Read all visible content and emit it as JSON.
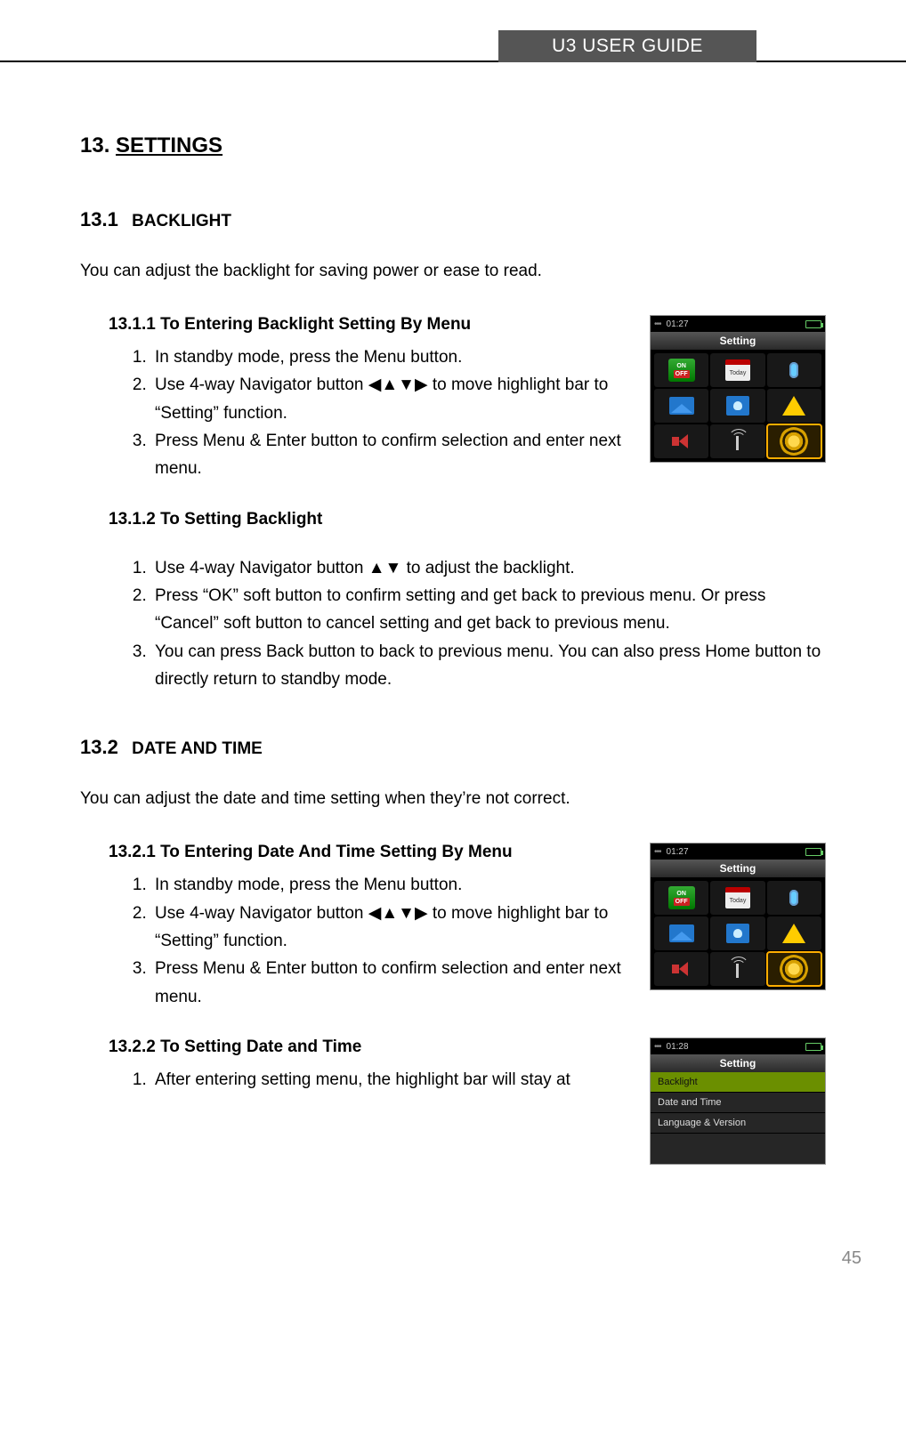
{
  "header": {
    "title": "U3 USER GUIDE"
  },
  "page_number": "45",
  "sections": {
    "h1_num": "13.",
    "h1_title": "SETTINGS",
    "s131": {
      "num": "13.1",
      "title": "BACKLIGHT",
      "intro": "You can adjust the backlight for saving power or ease to read.",
      "s1311": {
        "title": "13.1.1  To Entering Backlight Setting By Menu",
        "steps": [
          "In standby mode, press the Menu button.",
          "Use 4-way Navigator button ◀▲▼▶ to move highlight bar to “Setting” function.",
          "Press Menu & Enter button to confirm selection and enter next menu."
        ]
      },
      "s1312": {
        "title": "13.1.2  To Setting Backlight",
        "steps": [
          "Use 4-way Navigator button    ▲▼ to adjust the backlight.",
          "Press “OK” soft button to confirm setting and get back to previous menu. Or press “Cancel” soft button to cancel setting and get back to previous menu.",
          " You can press Back button to back to previous menu. You can also press Home button to directly return to standby mode."
        ]
      }
    },
    "s132": {
      "num": "13.2",
      "title": "DATE AND TIME",
      "intro": "You can adjust the date and time setting when they’re not correct.",
      "s1321": {
        "title": "13.2.1  To Entering Date And Time Setting By Menu",
        "steps": [
          "In standby mode, press the Menu button.",
          "Use 4-way Navigator button ◀▲▼▶ to move highlight bar to “Setting” function.",
          "Press Menu & Enter button to confirm selection and enter next menu."
        ]
      },
      "s1322": {
        "title": "13.2.2  To Setting Date and Time",
        "steps": [
          "After entering setting menu, the highlight bar will stay at"
        ]
      }
    }
  },
  "device_screens": {
    "grid1": {
      "time": "01:27",
      "title": "Setting",
      "icons": [
        "onoff",
        "calendar",
        "mic",
        "envelope",
        "contacts",
        "warning",
        "speaker",
        "antenna",
        "gear"
      ],
      "selected_index": 8,
      "cal_label": "Today"
    },
    "grid2": {
      "time": "01:27",
      "title": "Setting",
      "icons": [
        "onoff",
        "calendar",
        "mic",
        "envelope",
        "contacts",
        "warning",
        "speaker",
        "antenna",
        "gear"
      ],
      "selected_index": 8,
      "cal_label": "Today"
    },
    "list1": {
      "time": "01:28",
      "title": "Setting",
      "rows": [
        "Backlight",
        "Date and Time",
        "Language & Version"
      ],
      "selected_index": 0
    }
  },
  "onoff_labels": {
    "on": "ON",
    "off": "OFF"
  }
}
